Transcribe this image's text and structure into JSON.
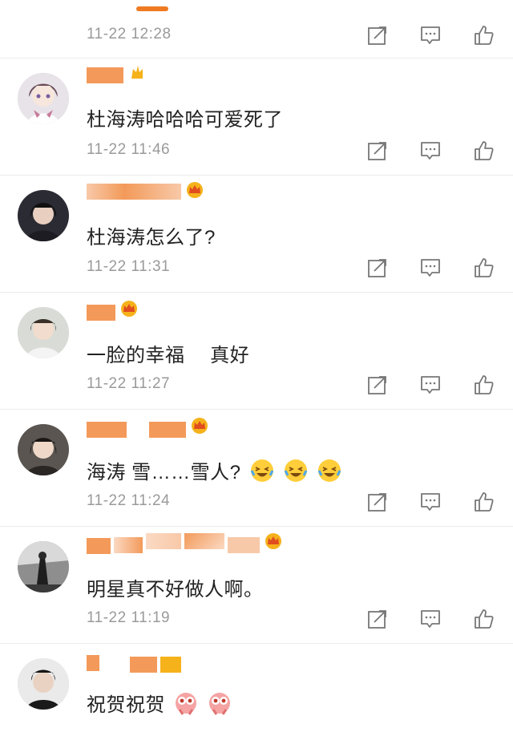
{
  "comments": [
    {
      "time": "11-22 12:28",
      "text": ""
    },
    {
      "time": "11-22 11:46",
      "text": "杜海涛哈哈哈可爱死了"
    },
    {
      "time": "11-22 11:31",
      "text": "杜海涛怎么了?"
    },
    {
      "time": "11-22 11:27",
      "text": "一脸的幸福　 真好"
    },
    {
      "time": "11-22 11:24",
      "text": "海涛 雪……雪人?"
    },
    {
      "time": "11-22 11:19",
      "text": "明星真不好做人啊。"
    },
    {
      "time": "",
      "text": "祝贺祝贺"
    }
  ],
  "icons": {
    "repost": "repost-icon",
    "comment": "comment-icon",
    "like": "thumbs-up-icon",
    "crown": "crown-badge-icon",
    "laugh": "laugh-cry-emoji",
    "flower": "flower-emoji"
  },
  "colors": {
    "accent": "#f07a22",
    "nickname_redacted": "#f39a5a",
    "text": "#222222",
    "meta": "#9a9a9a",
    "crown": "#f5b21b"
  }
}
